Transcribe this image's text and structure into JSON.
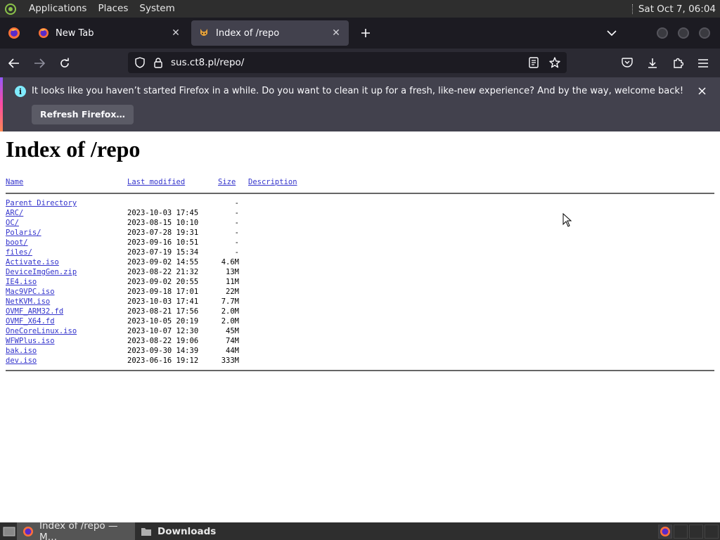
{
  "top_panel": {
    "menus": [
      "Applications",
      "Places",
      "System"
    ],
    "clock": "Sat Oct  7, 06:04"
  },
  "tabs": [
    {
      "title": "New Tab",
      "active": false
    },
    {
      "title": "Index of /repo",
      "active": true
    }
  ],
  "nav": {
    "url": "sus.ct8.pl/repo/"
  },
  "notification": {
    "message": "It looks like you haven’t started Firefox in a while. Do you want to clean it up for a fresh, like-new experience? And by the way, welcome back!",
    "button_label": "Refresh Firefox…"
  },
  "page": {
    "title": "Index of /repo",
    "columns": {
      "name": "Name",
      "modified": "Last modified",
      "size": "Size",
      "description": "Description"
    },
    "parent": {
      "name": "Parent Directory",
      "size": "-"
    },
    "entries": [
      {
        "name": "ARC/",
        "modified": "2023-10-03 17:45",
        "size": "-"
      },
      {
        "name": "OC/",
        "modified": "2023-08-15 10:10",
        "size": "-"
      },
      {
        "name": "Polaris/",
        "modified": "2023-07-28 19:31",
        "size": "-"
      },
      {
        "name": "boot/",
        "modified": "2023-09-16 10:51",
        "size": "-"
      },
      {
        "name": "files/",
        "modified": "2023-07-19 15:34",
        "size": "-"
      },
      {
        "name": "Activate.iso",
        "modified": "2023-09-02 14:55",
        "size": "4.6M"
      },
      {
        "name": "DeviceImgGen.zip",
        "modified": "2023-08-22 21:32",
        "size": "13M"
      },
      {
        "name": "IE4.iso",
        "modified": "2023-09-02 20:55",
        "size": "11M"
      },
      {
        "name": "Mac9VPC.iso",
        "modified": "2023-09-18 17:01",
        "size": "22M"
      },
      {
        "name": "NetKVM.iso",
        "modified": "2023-10-03 17:41",
        "size": "7.7M"
      },
      {
        "name": "OVMF_ARM32.fd",
        "modified": "2023-08-21 17:56",
        "size": "2.0M"
      },
      {
        "name": "OVMF_X64.fd",
        "modified": "2023-10-05 20:19",
        "size": "2.0M"
      },
      {
        "name": "OneCoreLinux.iso",
        "modified": "2023-10-07 12:30",
        "size": "45M"
      },
      {
        "name": "WFWPlus.iso",
        "modified": "2023-08-22 19:06",
        "size": "74M"
      },
      {
        "name": "bak.iso",
        "modified": "2023-09-30 14:39",
        "size": "44M"
      },
      {
        "name": "dev.iso",
        "modified": "2023-06-16 19:12",
        "size": "333M"
      }
    ]
  },
  "taskbar": {
    "tasks": [
      {
        "label": "Index of /repo — M…",
        "active": true
      },
      {
        "label": "Downloads",
        "active": false
      }
    ]
  }
}
